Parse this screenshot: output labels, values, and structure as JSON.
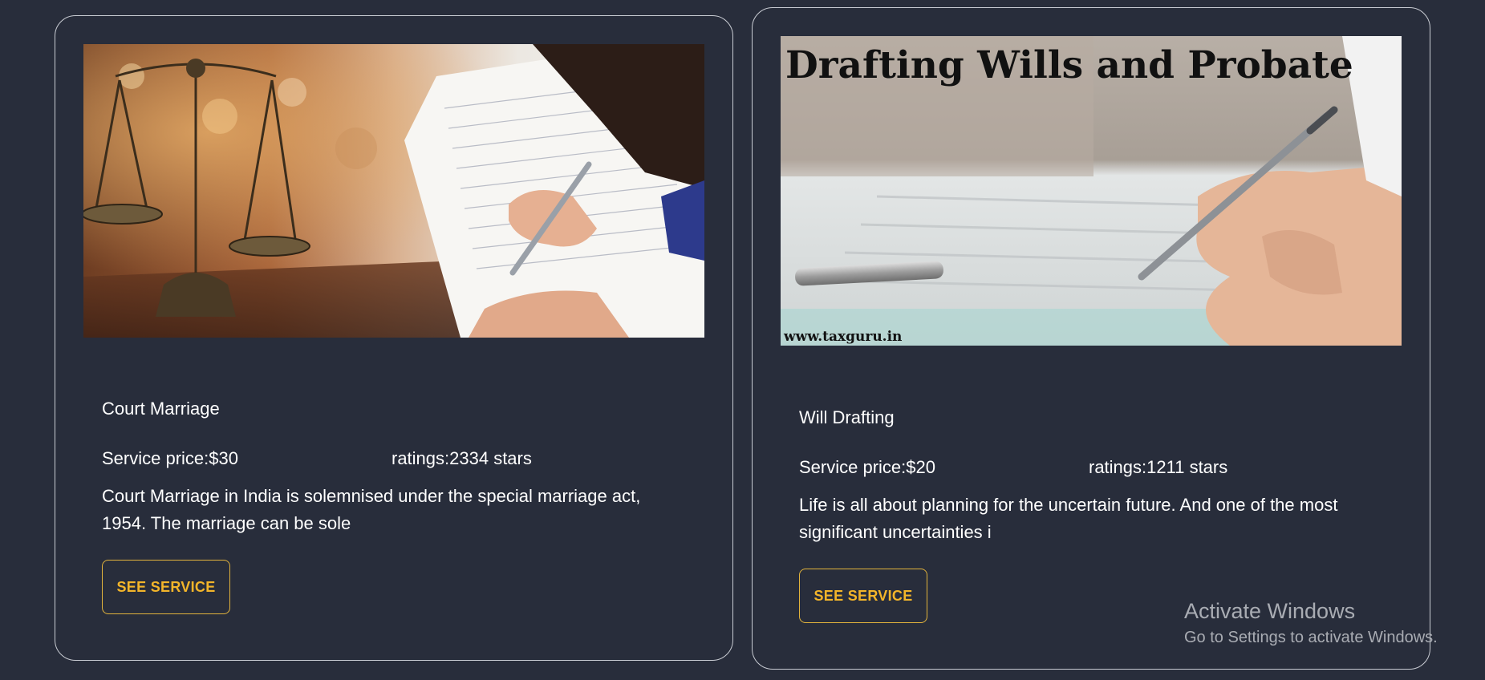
{
  "cards": [
    {
      "title": "Court Marriage",
      "price": "Service price:$30",
      "rating": "ratings:2334 stars",
      "description": "Court Marriage in India is solemnised under the special marriage act, 1954. The marriage can be sole",
      "button_label": "SEE SERVICE",
      "image": "scales-of-justice-signing-document-photo"
    },
    {
      "title": "Will Drafting",
      "price": "Service price:$20",
      "rating": "ratings:1211 stars",
      "description": "Life is all about planning for the uncertain future. And one of the most significant uncertainties i",
      "button_label": "SEE SERVICE",
      "image": "drafting-wills-pen-photo",
      "image_text": {
        "banner": "Drafting Wills and Probate",
        "site": "www.taxguru.in"
      }
    }
  ],
  "watermark": {
    "title": "Activate Windows",
    "subtitle": "Go to Settings to activate Windows."
  },
  "colors": {
    "background": "#282d3b",
    "card_border": "#c9ccd3",
    "accent": "#f3b52a"
  }
}
